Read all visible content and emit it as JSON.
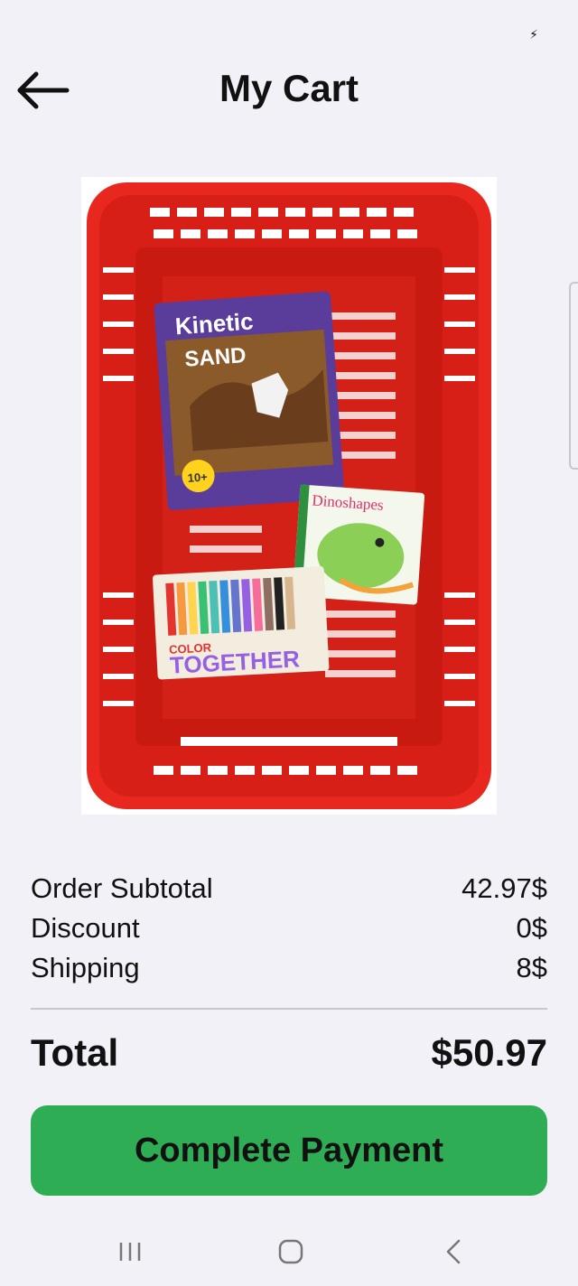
{
  "header": {
    "title": "My Cart"
  },
  "hero": {
    "items": [
      {
        "brand": "Kinetic",
        "sub": "SAND",
        "badge": "10+"
      },
      {
        "title": "Dinoshapes"
      },
      {
        "title_a": "COLOR",
        "title_b": "TOGETHER"
      }
    ]
  },
  "summary": {
    "rows": [
      {
        "label": "Order Subtotal",
        "value": "42.97$"
      },
      {
        "label": "Discount",
        "value": "0$"
      },
      {
        "label": "Shipping",
        "value": "8$"
      }
    ]
  },
  "total": {
    "label": "Total",
    "value": "$50.97"
  },
  "actions": {
    "pay_label": "Complete Payment"
  },
  "colors": {
    "accent": "#2fad55",
    "basket": "#e8281f",
    "background": "#f3f1f8"
  },
  "icons": {
    "back": "arrow-left-icon",
    "recents": "recents-icon",
    "home": "home-icon",
    "nav_back": "nav-back-icon"
  }
}
